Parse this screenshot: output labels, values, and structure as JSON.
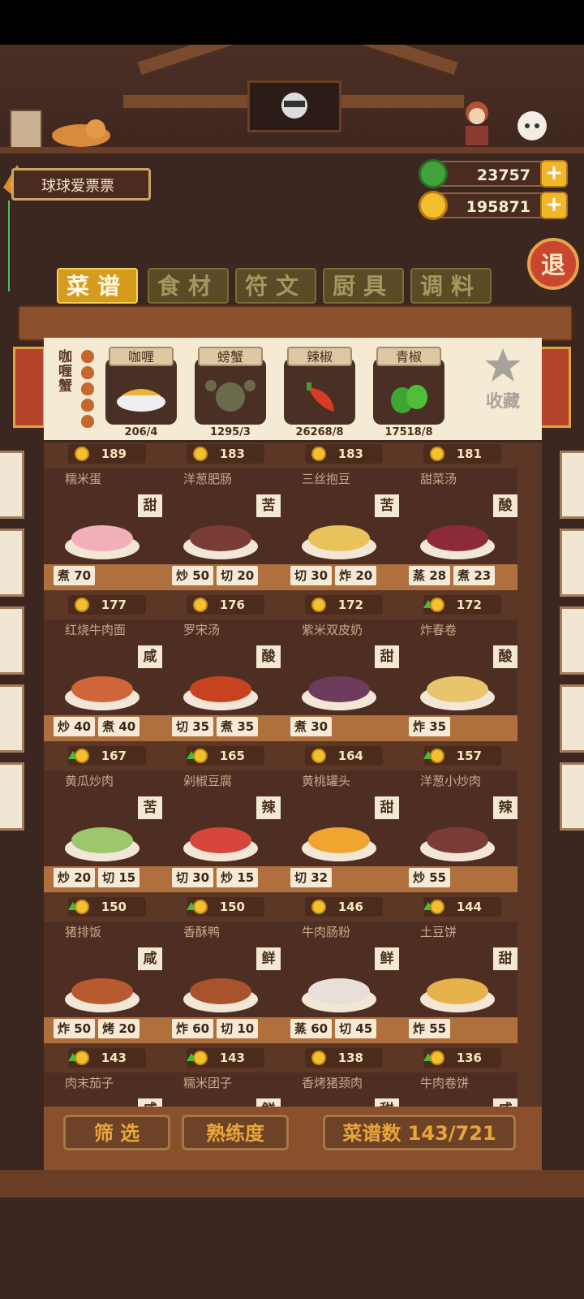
{
  "player": {
    "name": "球球爱票票"
  },
  "currencies": {
    "green": "23757",
    "gold": "195871"
  },
  "exit_label": "退",
  "tabs": [
    {
      "label": "菜谱",
      "active": true
    },
    {
      "label": "食材",
      "active": false
    },
    {
      "label": "符文",
      "active": false
    },
    {
      "label": "厨具",
      "active": false
    },
    {
      "label": "调料",
      "active": false
    }
  ],
  "filter": {
    "current_dish": "咖喱蟹",
    "ingredients": [
      {
        "name": "咖喱",
        "count": "206/4",
        "icon": "curry-sauce-icon"
      },
      {
        "name": "螃蟹",
        "count": "1295/3",
        "icon": "crab-icon"
      },
      {
        "name": "辣椒",
        "count": "26268/8",
        "icon": "red-pepper-icon"
      },
      {
        "name": "青椒",
        "count": "17518/8",
        "icon": "green-pepper-icon"
      }
    ],
    "favorite_label": "收藏"
  },
  "recipes": [
    {
      "price": "189",
      "up": false,
      "name": "糯米蛋",
      "taste": "甜",
      "tags": [
        "煮 70"
      ]
    },
    {
      "price": "183",
      "up": false,
      "name": "洋葱肥肠",
      "taste": "苦",
      "tags": [
        "炒 50",
        "切 20"
      ]
    },
    {
      "price": "183",
      "up": false,
      "name": "三丝抱豆",
      "taste": "苦",
      "tags": [
        "切 30",
        "炸 20"
      ]
    },
    {
      "price": "181",
      "up": false,
      "name": "甜菜汤",
      "taste": "酸",
      "tags": [
        "蒸 28",
        "煮 23"
      ]
    },
    {
      "price": "177",
      "up": false,
      "name": "红烧牛肉面",
      "taste": "咸",
      "tags": [
        "炒 40",
        "煮 40"
      ]
    },
    {
      "price": "176",
      "up": false,
      "name": "罗宋汤",
      "taste": "酸",
      "tags": [
        "切 35",
        "煮 35"
      ]
    },
    {
      "price": "172",
      "up": false,
      "name": "紫米双皮奶",
      "taste": "甜",
      "tags": [
        "煮 30"
      ]
    },
    {
      "price": "172",
      "up": true,
      "name": "炸春卷",
      "taste": "酸",
      "tags": [
        "炸 35"
      ]
    },
    {
      "price": "167",
      "up": true,
      "name": "黄瓜炒肉",
      "taste": "苦",
      "tags": [
        "炒 20",
        "切 15"
      ]
    },
    {
      "price": "165",
      "up": true,
      "name": "剁椒豆腐",
      "taste": "辣",
      "tags": [
        "切 30",
        "炒 15"
      ]
    },
    {
      "price": "164",
      "up": false,
      "name": "黄桃罐头",
      "taste": "甜",
      "tags": [
        "切 32"
      ]
    },
    {
      "price": "157",
      "up": true,
      "name": "洋葱小炒肉",
      "taste": "辣",
      "tags": [
        "炒 55"
      ]
    },
    {
      "price": "150",
      "up": true,
      "name": "猪排饭",
      "taste": "咸",
      "tags": [
        "炸 50",
        "烤 20"
      ]
    },
    {
      "price": "150",
      "up": true,
      "name": "香酥鸭",
      "taste": "鲜",
      "tags": [
        "炸 60",
        "切 10"
      ]
    },
    {
      "price": "146",
      "up": false,
      "name": "牛肉肠粉",
      "taste": "鲜",
      "tags": [
        "蒸 60",
        "切 45"
      ]
    },
    {
      "price": "144",
      "up": true,
      "name": "土豆饼",
      "taste": "甜",
      "tags": [
        "炸 55"
      ]
    },
    {
      "price": "143",
      "up": true,
      "name": "肉末茄子",
      "taste": "咸",
      "tags": []
    },
    {
      "price": "143",
      "up": true,
      "name": "糯米团子",
      "taste": "鲜",
      "tags": []
    },
    {
      "price": "138",
      "up": false,
      "name": "香烤猪颈肉",
      "taste": "甜",
      "tags": []
    },
    {
      "price": "136",
      "up": true,
      "name": "牛肉卷饼",
      "taste": "咸",
      "tags": []
    }
  ],
  "bottom": {
    "filter_label": "筛 选",
    "mastery_label": "熟练度",
    "recipe_count": "菜谱数 143/721"
  },
  "colors": {
    "accent": "#d69a1c",
    "wood": "#8a4f2b",
    "panel": "#f5ead3"
  }
}
